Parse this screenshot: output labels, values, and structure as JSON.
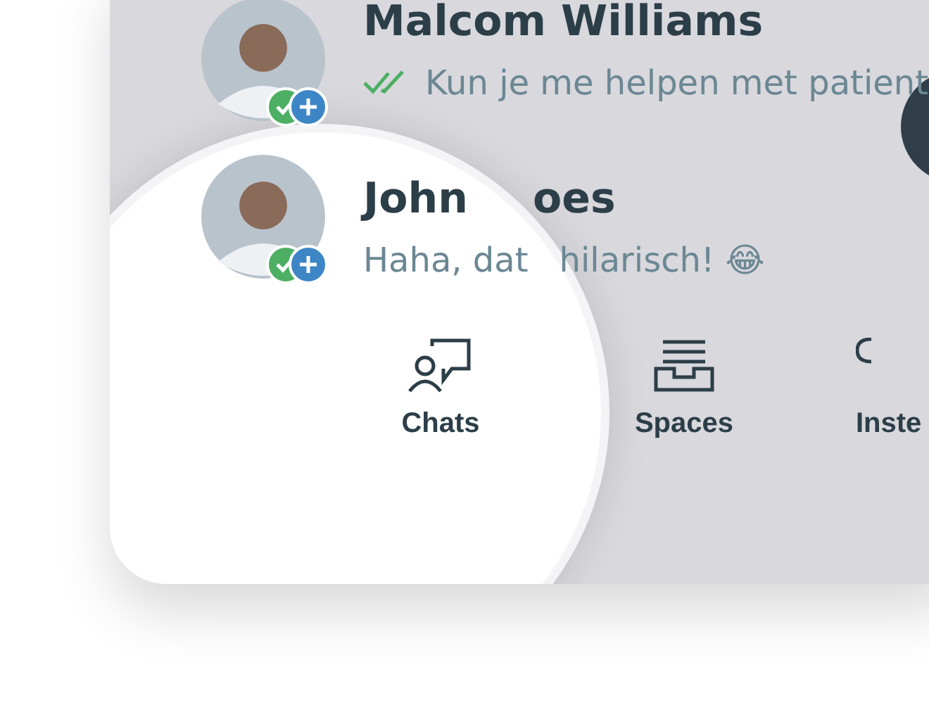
{
  "chats": [
    {
      "name_parts": [
        "Malcom Williams"
      ],
      "message_parts": [
        "Kun je me helpen met patient"
      ],
      "read": true
    },
    {
      "name_parts": [
        "John",
        "oes"
      ],
      "message_parts": [
        "Haha, dat",
        "hilarisch! 😂"
      ],
      "read": false
    }
  ],
  "nav": [
    {
      "label": "Chats"
    },
    {
      "label": "Spaces"
    },
    {
      "label": "Inste"
    }
  ]
}
